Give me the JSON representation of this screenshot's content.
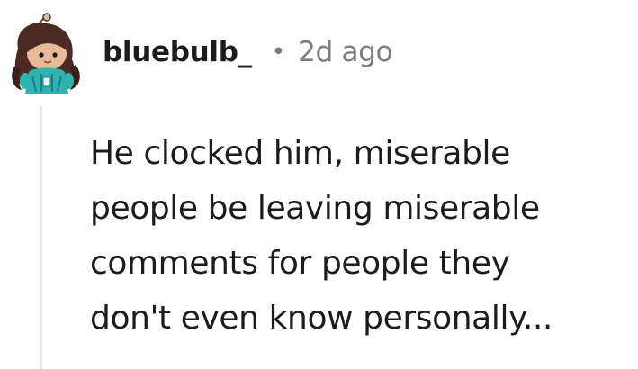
{
  "comment": {
    "avatar_icon": "snoo-avatar-icon",
    "username": "bluebulb_",
    "separator": "•",
    "timestamp": "2d ago",
    "body_lines": [
      "He clocked him, miserable",
      "people be leaving miserable",
      "comments for people they",
      "don't even know personally..."
    ]
  },
  "colors": {
    "background": "#ffffff",
    "text": "#1c1c1c",
    "meta": "#7c7c7c",
    "thread_line": "#e3e5e8"
  }
}
